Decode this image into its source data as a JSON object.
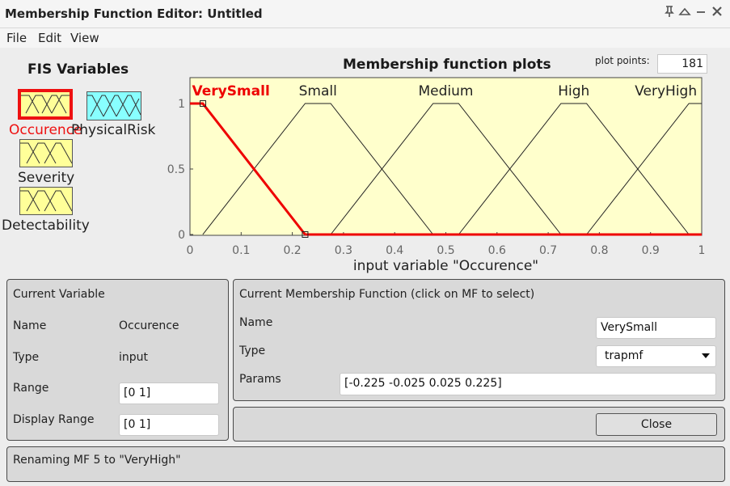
{
  "window": {
    "title": "Membership Function Editor: Untitled"
  },
  "menu": {
    "items": [
      "File",
      "Edit",
      "View"
    ]
  },
  "fis_variables": {
    "title": "FIS Variables",
    "variables": [
      {
        "label": "Occurence",
        "selected": true,
        "color": "#ffff99"
      },
      {
        "label": "PhysicalRisk",
        "selected": false,
        "color": "#88ffff"
      },
      {
        "label": "Severity",
        "selected": false,
        "color": "#ffff99"
      },
      {
        "label": "Detectability",
        "selected": false,
        "color": "#ffff99"
      }
    ]
  },
  "plot": {
    "title": "Membership function plots",
    "plot_points_label": "plot points:",
    "plot_points_value": "181"
  },
  "chart_data": {
    "type": "line",
    "xlabel": "input variable \"Occurence\"",
    "ylabel": "",
    "xlim": [
      0,
      1
    ],
    "ylim": [
      0,
      1
    ],
    "x_ticks": [
      "0",
      "0.1",
      "0.2",
      "0.3",
      "0.4",
      "0.5",
      "0.6",
      "0.7",
      "0.8",
      "0.9",
      "1"
    ],
    "y_ticks": [
      "0",
      "0.5",
      "1"
    ],
    "background": "#ffffcc",
    "selected_color": "#ee0000",
    "series": [
      {
        "name": "VerySmall",
        "mf_type": "trapmf",
        "params": [
          -0.225,
          -0.025,
          0.025,
          0.225
        ],
        "selected": true
      },
      {
        "name": "Small",
        "mf_type": "trapmf",
        "params": [
          0.025,
          0.225,
          0.275,
          0.475
        ],
        "selected": false
      },
      {
        "name": "Medium",
        "mf_type": "trapmf",
        "params": [
          0.275,
          0.475,
          0.525,
          0.725
        ],
        "selected": false
      },
      {
        "name": "High",
        "mf_type": "trapmf",
        "params": [
          0.525,
          0.725,
          0.775,
          0.975
        ],
        "selected": false
      },
      {
        "name": "VeryHigh",
        "mf_type": "trapmf",
        "params": [
          0.775,
          0.975,
          1.025,
          1.225
        ],
        "selected": false
      }
    ]
  },
  "current_variable": {
    "title": "Current Variable",
    "name_label": "Name",
    "name_value": "Occurence",
    "type_label": "Type",
    "type_value": "input",
    "range_label": "Range",
    "range_value": "[0 1]",
    "display_range_label": "Display Range",
    "display_range_value": "[0 1]"
  },
  "current_mf": {
    "title": "Current Membership Function (click on MF to select)",
    "name_label": "Name",
    "name_value": "VerySmall",
    "type_label": "Type",
    "type_value": "trapmf",
    "params_label": "Params",
    "params_value": "[-0.225 -0.025 0.025 0.225]"
  },
  "buttons": {
    "close_label": "Close"
  },
  "status": {
    "message": "Renaming MF 5 to \"VeryHigh\""
  }
}
